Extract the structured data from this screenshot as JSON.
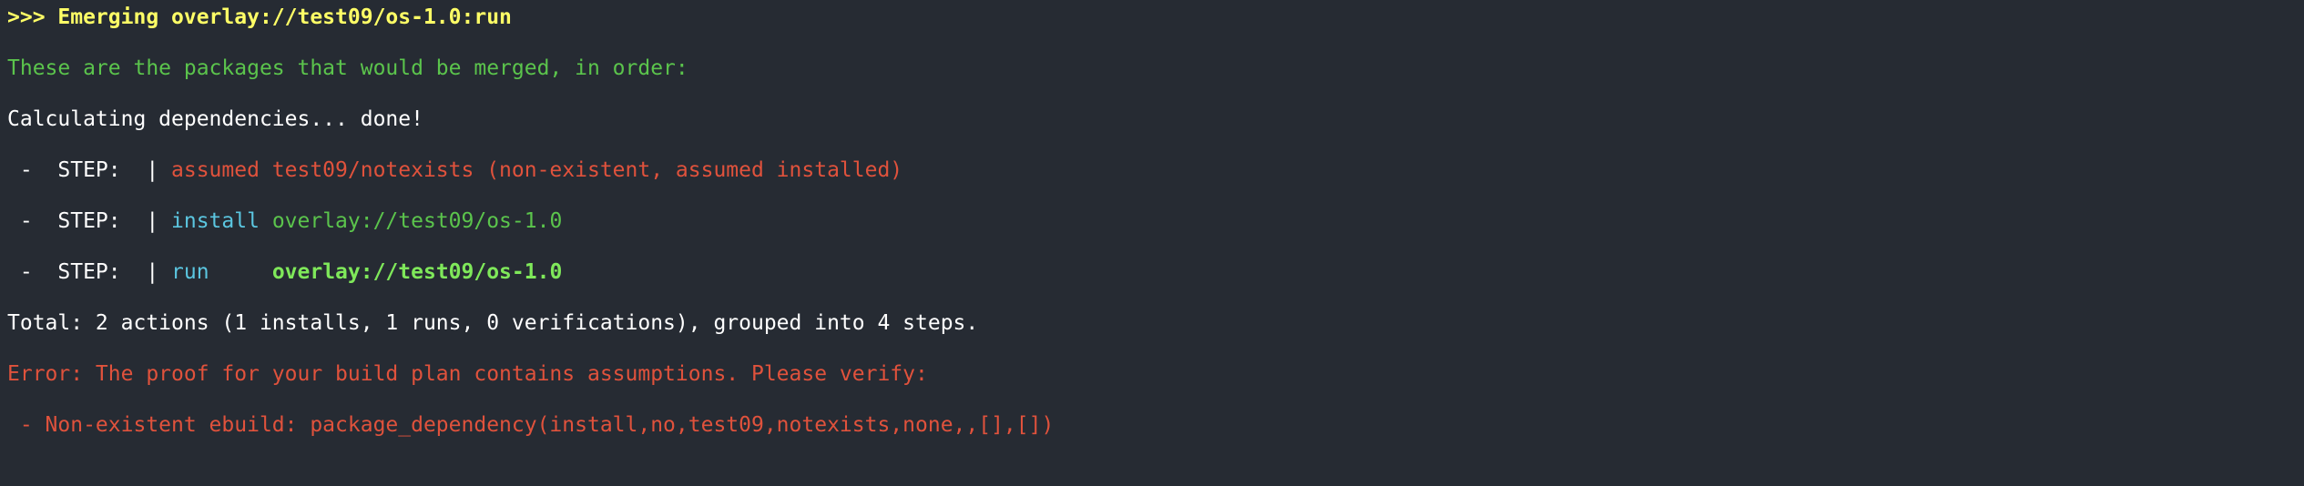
{
  "terminal": {
    "emerge_line": ">>> Emerging overlay://test09/os-1.0:run",
    "merge_header": "These are the packages that would be merged, in order:",
    "calculating": "Calculating dependencies... done!",
    "steps": [
      {
        "prefix": " -  STEP:  | ",
        "action": "assumed test09/notexists (non-existent, assumed installed)",
        "target": ""
      },
      {
        "prefix": " -  STEP:  | ",
        "action": "install",
        "target": "overlay://test09/os-1.0"
      },
      {
        "prefix": " -  STEP:  | ",
        "action": "run    ",
        "target": "overlay://test09/os-1.0"
      }
    ],
    "total": "Total: 2 actions (1 installs, 1 runs, 0 verifications), grouped into 4 steps.",
    "error": "Error: The proof for your build plan contains assumptions. Please verify:",
    "error_detail": " - Non-existent ebuild: package_dependency(install,no,test09,notexists,none,,[],[])"
  },
  "colors": {
    "background": "#262b33",
    "yellow": "#ffff66",
    "green": "#5bc44c",
    "bright_green": "#7fe85a",
    "red": "#e0523c",
    "cyan": "#5bc6e0",
    "white": "#ffffff"
  }
}
